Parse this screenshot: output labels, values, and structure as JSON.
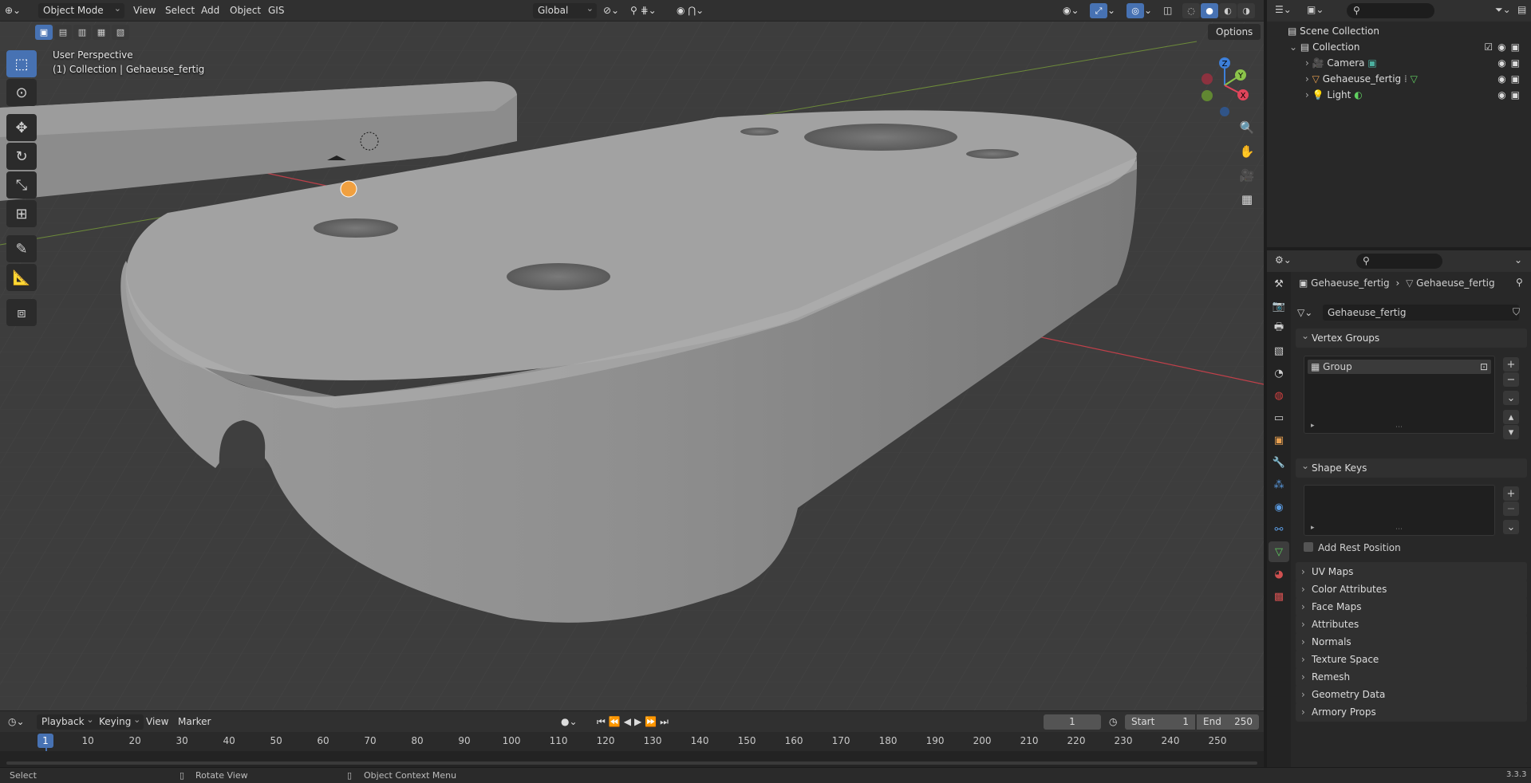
{
  "header": {
    "mode": "Object Mode",
    "menus": [
      "View",
      "Select",
      "Add",
      "Object",
      "GIS"
    ],
    "orientation": "Global"
  },
  "viewport": {
    "perspective": "User Perspective",
    "collection_info": "(1) Collection | Gehaeuse_fertig",
    "options": "Options"
  },
  "timeline": {
    "playback": "Playback",
    "keying": "Keying",
    "view": "View",
    "marker": "Marker",
    "current_frame": "1",
    "start_label": "Start",
    "start": "1",
    "end_label": "End",
    "end": "250",
    "ticks": [
      "1",
      "10",
      "20",
      "30",
      "40",
      "50",
      "60",
      "70",
      "80",
      "90",
      "100",
      "110",
      "120",
      "130",
      "140",
      "150",
      "160",
      "170",
      "180",
      "190",
      "200",
      "210",
      "220",
      "230",
      "240",
      "250"
    ]
  },
  "status": {
    "select": "Select",
    "rotate": "Rotate View",
    "context": "Object Context Menu",
    "version": "3.3.3"
  },
  "outliner": {
    "scene_collection": "Scene Collection",
    "collection": "Collection",
    "items": [
      "Camera",
      "Gehaeuse_fertig",
      "Light"
    ]
  },
  "props": {
    "breadcrumb_obj": "Gehaeuse_fertig",
    "breadcrumb_data": "Gehaeuse_fertig",
    "mesh_name": "Gehaeuse_fertig",
    "vertex_groups": "Vertex Groups",
    "group": "Group",
    "shape_keys": "Shape Keys",
    "add_rest": "Add Rest Position",
    "panels": [
      "UV Maps",
      "Color Attributes",
      "Face Maps",
      "Attributes",
      "Normals",
      "Texture Space",
      "Remesh",
      "Geometry Data",
      "Armory Props"
    ]
  },
  "colors": {
    "accent": "#4772b3",
    "x_axis": "#e0455b",
    "y_axis": "#8bc34a",
    "z_axis": "#3d7fd9"
  }
}
